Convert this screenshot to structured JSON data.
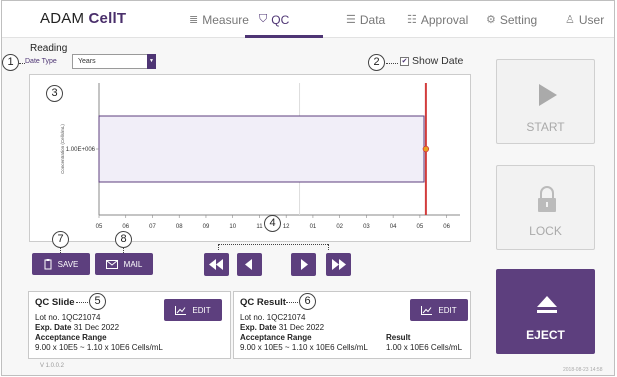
{
  "header": {
    "app_name_prefix": "ADAM ",
    "app_name_suffix": "CellT",
    "nav": [
      {
        "label": "Measure",
        "icon": "list-icon",
        "glyph": "≣",
        "active": false
      },
      {
        "label": "QC",
        "icon": "shield-check-icon",
        "glyph": "⛉",
        "active": true
      },
      {
        "label": "Data",
        "icon": "bullet-list-icon",
        "glyph": "☰",
        "active": false
      },
      {
        "label": "Approval",
        "icon": "checklist-icon",
        "glyph": "☷",
        "active": false
      },
      {
        "label": "Setting",
        "icon": "gear-icon",
        "glyph": "⚙",
        "active": false
      },
      {
        "label": "User",
        "icon": "user-icon",
        "glyph": "♙",
        "active": false
      }
    ]
  },
  "reading": {
    "title": "Reading",
    "date_type_label": "Date Type",
    "date_type_value": "Years",
    "show_date_label": "Show Date",
    "show_date_checked": true
  },
  "callouts": [
    "1",
    "2",
    "3",
    "4",
    "5",
    "6",
    "7",
    "8"
  ],
  "chart_data": {
    "type": "line",
    "ylabel": "Concentration (Cells/mL)",
    "y_tick_label": "1.00E+006",
    "x_tick_labels": [
      "05",
      "06",
      "07",
      "08",
      "09",
      "10",
      "11",
      "12",
      "01",
      "02",
      "03",
      "04",
      "05",
      "06"
    ],
    "acceptance_band": {
      "low": 900000,
      "high": 1100000
    },
    "marker_x_label": "05",
    "point_value": 1000000,
    "colors": {
      "band_fill": "#f1eef8",
      "band_stroke": "#5d3f7e",
      "marker_line": "#d23c3c",
      "point": "#e8a020"
    }
  },
  "actions": {
    "save_label": "SAVE",
    "mail_label": "MAIL"
  },
  "qc_slide": {
    "title": "QC Slide",
    "lot_label": "Lot no.",
    "lot_value": "1QC21074",
    "exp_label": "Exp. Date",
    "exp_value": "31 Dec 2022",
    "range_label": "Acceptance Range",
    "range_value": "9.00 x 10E5 ~ 1.10 x 10E6 Cells/mL",
    "edit_label": "EDIT"
  },
  "qc_result": {
    "title": "QC Result",
    "lot_label": "Lot no.",
    "lot_value": "1QC21074",
    "exp_label": "Exp. Date",
    "exp_value": "31 Dec 2022",
    "range_label": "Acceptance Range",
    "range_value": "9.00 x 10E5 ~ 1.10 x 10E6 Cells/mL",
    "result_label": "Result",
    "result_value": "1.00 x 10E6 Cells/mL",
    "edit_label": "EDIT"
  },
  "side": {
    "start_label": "START",
    "lock_label": "LOCK",
    "eject_label": "EJECT"
  },
  "footer": {
    "version": "V 1.0.0.2",
    "timestamp": "2018-08-23 14:58"
  },
  "colors": {
    "accent": "#5d3f7e",
    "marker": "#d23c3c"
  }
}
